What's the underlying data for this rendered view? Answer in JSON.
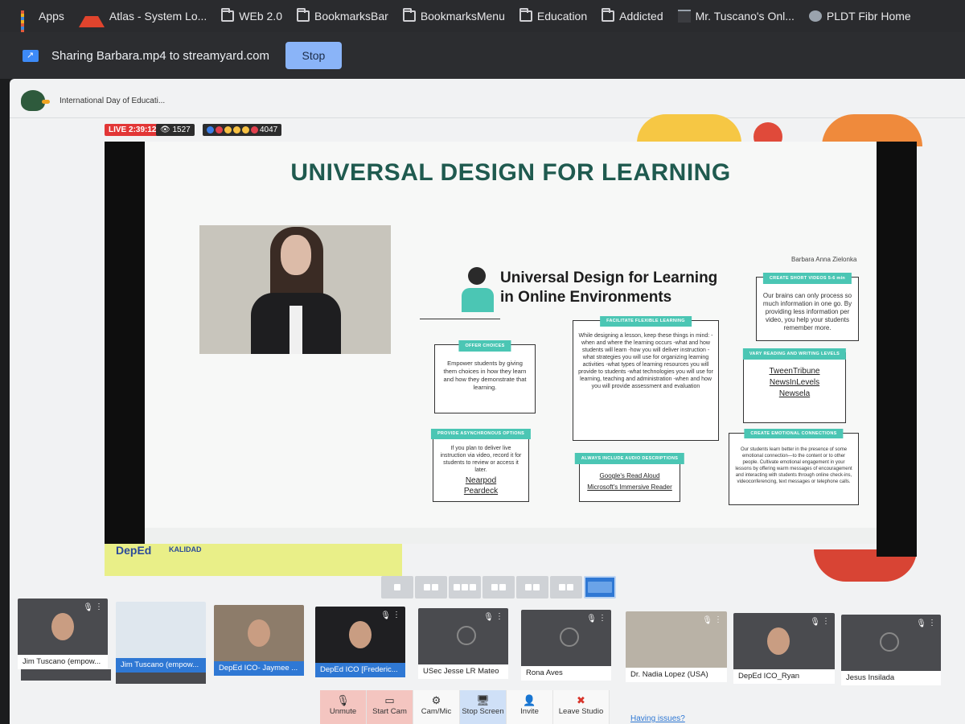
{
  "bookmarks": {
    "items": [
      {
        "icon": "apps-icon",
        "label": "Apps"
      },
      {
        "icon": "atlas-icon",
        "label": "Atlas - System Lo..."
      },
      {
        "icon": "folder-icon",
        "label": "WEb 2.0"
      },
      {
        "icon": "folder-icon",
        "label": "BookmarksBar"
      },
      {
        "icon": "folder-icon",
        "label": "BookmarksMenu"
      },
      {
        "icon": "folder-icon",
        "label": "Education"
      },
      {
        "icon": "folder-icon",
        "label": "Addicted"
      },
      {
        "icon": "page-icon",
        "label": "Mr. Tuscano's Onl..."
      },
      {
        "icon": "globe-icon",
        "label": "PLDT Fibr Home"
      }
    ]
  },
  "sharing": {
    "text": "Sharing Barbara.mp4 to streamyard.com",
    "stop_label": "Stop"
  },
  "studio": {
    "title": "International Day of Educati..."
  },
  "stats": {
    "live": "LIVE 2:39:12",
    "views": "1527",
    "reactions": "4047"
  },
  "slide": {
    "title": "UNIVERSAL DESIGN FOR LEARNING",
    "author": "Barbara Anna Zielonka",
    "heading_line1": "Universal Design for Learning",
    "heading_line2": "in Online Environments",
    "boxes": {
      "offer_choices": {
        "tag": "OFFER CHOICES",
        "text": "Empower students by giving them choices in how they learn and how they demonstrate that learning."
      },
      "facilitate": {
        "tag": "FACILITATE FLEXIBLE LEARNING",
        "text": "While designing a lesson, keep these things in mind: -when and where the learning occurs -what and how students will learn -how you will deliver instruction -what strategies you will use for organizing learning activities -what types of learning resources you will provide to students -what technologies you will use for learning, teaching and administration -when and how you will provide assessment and evaluation"
      },
      "short_videos": {
        "tag": "CREATE SHORT VIDEOS 5-6 min",
        "text": "Our brains can only process so much information in one go. By providing less information per video, you help your students remember more."
      },
      "reading": {
        "tag": "VARY READING AND WRITING LEVELS",
        "links": [
          "TweenTribune",
          "NewsInLevels",
          "Newsela"
        ]
      },
      "async": {
        "tag": "PROVIDE ASYNCHRONOUS OPTIONS",
        "text": "If you plan to deliver live instruction via video, record it for students to review or access it later.",
        "links": [
          "Nearpod",
          "Peardeck"
        ]
      },
      "audio": {
        "tag": "ALWAYS INCLUDE AUDIO DESCRIPTIONS",
        "links": [
          "Google's Read Aloud",
          "Microsoft's Immersive Reader"
        ]
      },
      "emotional": {
        "tag": "CREATE EMOTIONAL CONNECTIONS",
        "text": "Our students learn better in the presence of some emotional connection—to the content or to other people. Cultivate emotional engagement in your lessons by offering warm messages of encouragement and interacting with students through online check-ins, videoconferencing, text messages or telephone calls."
      }
    }
  },
  "logos": {
    "deped": "DepEd",
    "kalidad": "KALIDAD"
  },
  "participants": [
    {
      "name": "Jim Tuscano (empow...",
      "muted": true
    },
    {
      "name": "Jim Tuscano (empow...",
      "muted": false,
      "selected": true
    },
    {
      "name": "DepEd ICO- Jaymee ...",
      "muted": false,
      "selected": true
    },
    {
      "name": "DepEd ICO [Frederic...",
      "muted": true,
      "selected": true
    },
    {
      "name": "USec Jesse LR Mateo",
      "muted": true
    },
    {
      "name": "Rona Aves",
      "muted": true
    },
    {
      "name": "Dr. Nadia Lopez (USA)",
      "muted": false
    },
    {
      "name": "DepEd ICO_Ryan",
      "muted": true
    },
    {
      "name": "Jesus Insilada",
      "muted": true
    }
  ],
  "controls": [
    {
      "icon": "mic-off-icon",
      "label": "Unmute"
    },
    {
      "icon": "camera-off-icon",
      "label": "Start Cam"
    },
    {
      "icon": "gear-icon",
      "label": "Cam/Mic"
    },
    {
      "icon": "monitor-icon",
      "label": "Stop Screen"
    },
    {
      "icon": "add-person-icon",
      "label": "Invite"
    },
    {
      "icon": "close-icon",
      "label": "Leave Studio"
    }
  ],
  "help_link": "Having issues?",
  "colors": {
    "accent": "#2f78d4",
    "teal": "#4bc6b4",
    "title_green": "#1f5a4f",
    "live_red": "#e23636"
  }
}
